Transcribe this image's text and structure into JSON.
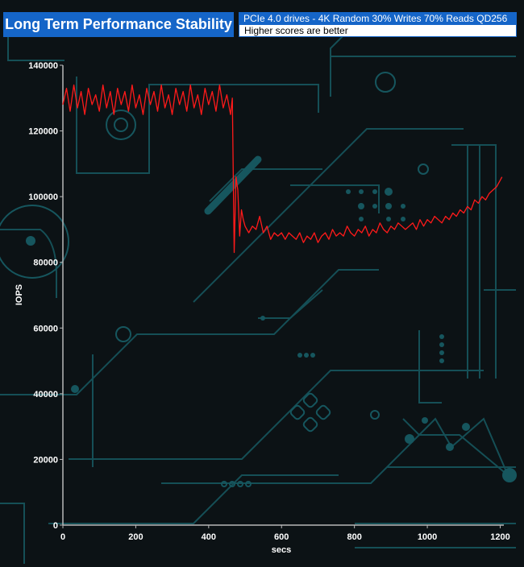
{
  "header": {
    "title": "Long Term Performance Stability",
    "subtitle": "PCIe 4.0 drives - 4K Random 30% Writes 70% Reads QD256",
    "note": "Higher scores are better"
  },
  "colors": {
    "series": "#ff1a1a",
    "title_bg": "#1565c8",
    "circuit": "#16565e",
    "axis": "#b8b8b8"
  },
  "chart_data": {
    "type": "line",
    "title": "Long Term Performance Stability",
    "xlabel": "secs",
    "ylabel": "IOPS",
    "xlim": [
      0,
      1210
    ],
    "ylim": [
      0,
      140000
    ],
    "x_ticks": [
      0,
      200,
      400,
      600,
      800,
      1000,
      1200
    ],
    "x_tick_labels": [
      "0",
      "200",
      "400",
      "600",
      "800",
      "1000",
      "1200"
    ],
    "y_ticks": [
      0,
      20000,
      40000,
      60000,
      80000,
      100000,
      120000,
      140000
    ],
    "y_tick_labels": [
      "0",
      "20000",
      "40000",
      "60000",
      "80000",
      "100000",
      "120000",
      "140000"
    ],
    "grid": false,
    "series": [
      {
        "x": [
          0,
          10,
          20,
          30,
          40,
          50,
          60,
          70,
          80,
          90,
          100,
          110,
          120,
          130,
          140,
          150,
          160,
          170,
          180,
          190,
          200,
          210,
          220,
          230,
          240,
          250,
          260,
          270,
          280,
          290,
          300,
          310,
          320,
          330,
          340,
          350,
          360,
          370,
          380,
          390,
          400,
          410,
          420,
          430,
          440,
          450,
          460,
          465,
          470,
          475,
          480,
          485,
          490,
          495,
          500,
          505,
          510,
          520,
          530,
          540,
          550,
          560,
          570,
          580,
          590,
          600,
          610,
          620,
          630,
          640,
          650,
          660,
          670,
          680,
          690,
          700,
          710,
          720,
          730,
          740,
          750,
          760,
          770,
          780,
          790,
          800,
          810,
          820,
          830,
          840,
          850,
          860,
          870,
          880,
          890,
          900,
          910,
          920,
          930,
          940,
          950,
          960,
          970,
          980,
          990,
          1000,
          1010,
          1020,
          1030,
          1040,
          1050,
          1060,
          1070,
          1080,
          1090,
          1100,
          1110,
          1120,
          1130,
          1140,
          1150,
          1160,
          1170,
          1180,
          1190,
          1200,
          1205
        ],
        "y": [
          128000,
          133000,
          126000,
          134000,
          127000,
          132000,
          125000,
          133000,
          128000,
          131000,
          126000,
          134000,
          127000,
          132000,
          125000,
          133000,
          128000,
          132000,
          126000,
          134000,
          127000,
          131000,
          125000,
          133000,
          128000,
          132000,
          126000,
          134000,
          127000,
          131000,
          125000,
          133000,
          128000,
          132000,
          126000,
          134000,
          127000,
          131000,
          125000,
          133000,
          128000,
          132000,
          126000,
          134000,
          127000,
          131000,
          125000,
          130000,
          83000,
          106000,
          102000,
          88000,
          96000,
          93000,
          91000,
          90000,
          89000,
          91000,
          90000,
          94000,
          89000,
          91000,
          87000,
          89000,
          88000,
          89000,
          87000,
          89000,
          88000,
          87000,
          89000,
          86000,
          88000,
          87000,
          89000,
          86000,
          88000,
          89000,
          87000,
          90000,
          88000,
          89000,
          88000,
          91000,
          89000,
          88000,
          90000,
          89000,
          91000,
          88000,
          90000,
          89000,
          92000,
          90000,
          89000,
          91000,
          90000,
          92000,
          91000,
          90000,
          91000,
          92000,
          90000,
          93000,
          91000,
          93000,
          92000,
          94000,
          93000,
          92000,
          94000,
          93000,
          95000,
          94000,
          96000,
          95000,
          97000,
          96000,
          99000,
          98000,
          100000,
          99000,
          101000,
          102000,
          103000,
          105000,
          106000
        ]
      }
    ]
  }
}
